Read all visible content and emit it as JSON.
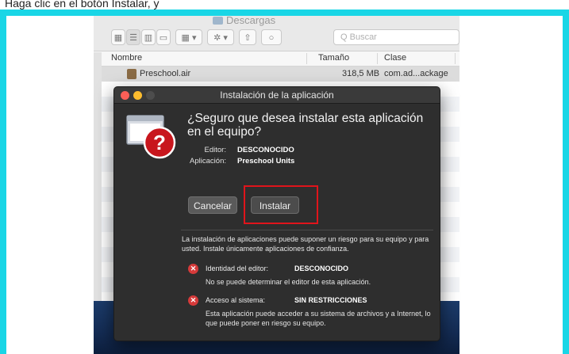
{
  "page": {
    "caption": "Haga clic en el botón Instalar, y"
  },
  "finder": {
    "title": "Descargas",
    "search_placeholder": "Q Buscar",
    "columns": {
      "name": "Nombre",
      "size": "Tamaño",
      "kind": "Clase"
    },
    "file": {
      "name": "Preschool.air",
      "size": "318,5 MB",
      "kind": "com.ad...ackage"
    }
  },
  "dialog": {
    "title": "Instalación de la aplicación",
    "question": "¿Seguro que desea instalar esta aplicación en el equipo?",
    "publisher_label": "Editor:",
    "publisher_value": "DESCONOCIDO",
    "app_label": "Aplicación:",
    "app_value": "Preschool Units",
    "cancel_label": "Cancelar",
    "install_label": "Instalar",
    "warning": "La instalación de aplicaciones puede suponer un riesgo para su equipo y para usted. Instale únicamente aplicaciones de confianza.",
    "risks": [
      {
        "label": "Identidad del editor:",
        "value": "DESCONOCIDO",
        "desc": "No se puede determinar el editor de esta aplicación."
      },
      {
        "label": "Acceso al sistema:",
        "value": "SIN RESTRICCIONES",
        "desc": "Esta aplicación puede acceder a su sistema de archivos y a Internet, lo que puede poner en riesgo su equipo."
      }
    ]
  },
  "colors": {
    "frame": "#19d6e6",
    "highlight": "#e0141b",
    "dialog_bg": "#2e2e2e",
    "risk_icon": "#d63a3a"
  }
}
